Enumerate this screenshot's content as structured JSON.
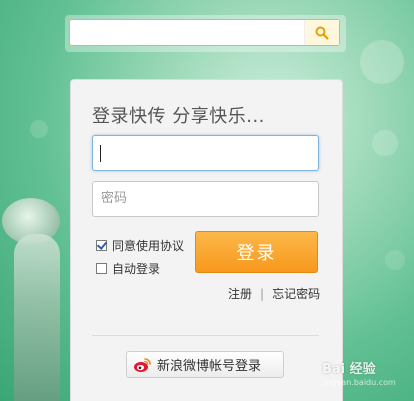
{
  "search": {
    "placeholder": "",
    "value": ""
  },
  "panel": {
    "title": "登录快传 分享快乐...",
    "username_placeholder": "",
    "password_placeholder": "密码",
    "agree_label": "同意使用协议",
    "agree_checked": true,
    "auto_login_label": "自动登录",
    "auto_login_checked": false,
    "login_label": "登录",
    "register_link": "注册",
    "link_separator": "|",
    "forgot_link": "忘记密码",
    "weibo_login_label": "新浪微博帐号登录"
  },
  "watermark": {
    "text": "Bai 经验",
    "sub": "jingyan.baidu.com"
  },
  "colors": {
    "accent_orange": "#f7981c",
    "search_border": "#e0b84a",
    "focus_blue": "#7fb3e0",
    "weibo_red": "#e6162d"
  }
}
